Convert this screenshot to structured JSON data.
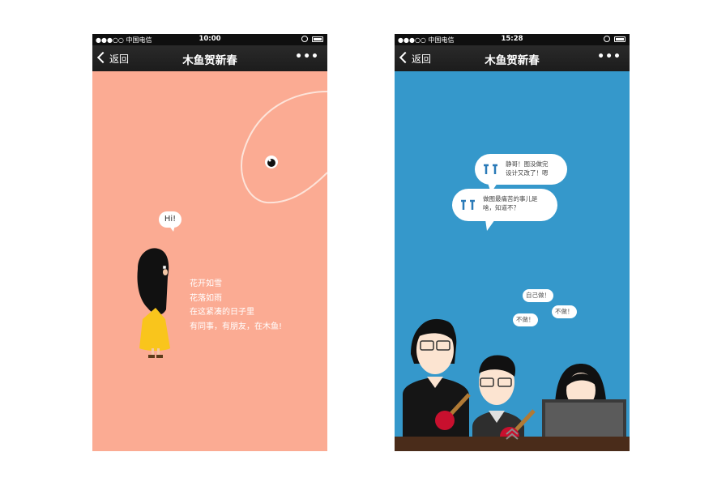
{
  "screens": [
    {
      "statusbar": {
        "carrier": "●●●○○ 中国电信",
        "time": "10:00"
      },
      "navbar": {
        "back_label": "返回",
        "title": "木鱼贺新春",
        "more_label": "•••"
      },
      "speech": "Hi!",
      "poem": [
        "花开如雪",
        "花落如雨",
        "在这紧凑的日子里",
        "有同事，有朋友，在木鱼!"
      ],
      "colors": {
        "background": "#fbab93"
      }
    },
    {
      "statusbar": {
        "carrier": "●●●○○ 中国电信",
        "time": "15:28"
      },
      "navbar": {
        "back_label": "返回",
        "title": "木鱼贺新春",
        "more_label": "•••"
      },
      "bubbles": [
        {
          "text": [
            "静哥！图没做完",
            "设计又改了！嗯"
          ]
        },
        {
          "text": [
            "做图最痛苦的事儿是",
            "啥，知道不？"
          ]
        }
      ],
      "small_bubbles": [
        "自己做！",
        "不做！",
        "不做！"
      ],
      "colors": {
        "background": "#3598cb"
      }
    }
  ]
}
